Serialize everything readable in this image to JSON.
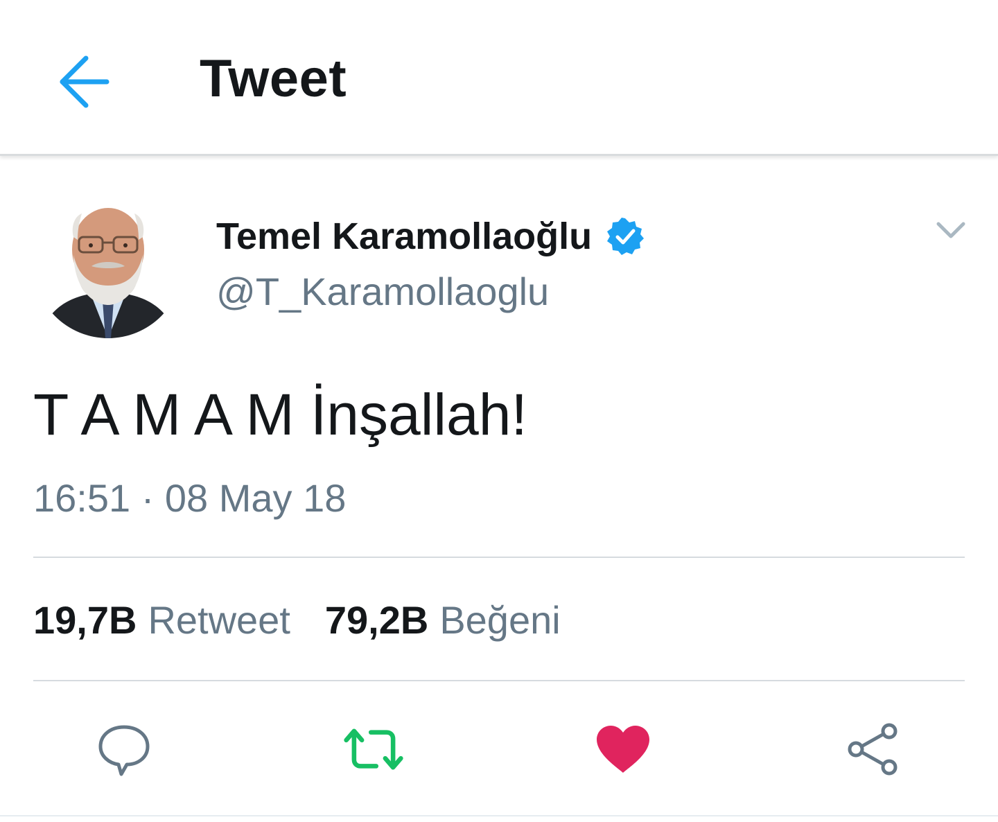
{
  "header": {
    "title": "Tweet",
    "back_icon": "arrow-left-icon"
  },
  "tweet": {
    "author": {
      "display_name": "Temel Karamollaoğlu",
      "handle": "@T_Karamollaoglu",
      "verified": true,
      "avatar_icon": "profile-photo"
    },
    "text": "T A M A M İnşallah!",
    "timestamp": "16:51 · 08 May 18",
    "stats": {
      "retweet_count": "19,7B",
      "retweet_label": "Retweet",
      "like_count": "79,2B",
      "like_label": "Beğeni"
    },
    "actions": {
      "reply_icon": "reply-icon",
      "retweet_icon": "retweet-icon",
      "like_icon": "heart-icon",
      "share_icon": "share-icon"
    }
  },
  "colors": {
    "accent_blue": "#1da1f2",
    "text_primary": "#14171a",
    "text_secondary": "#657786",
    "retweet_green": "#17bf63",
    "like_red": "#e0245e",
    "divider": "#d6dbdf"
  }
}
